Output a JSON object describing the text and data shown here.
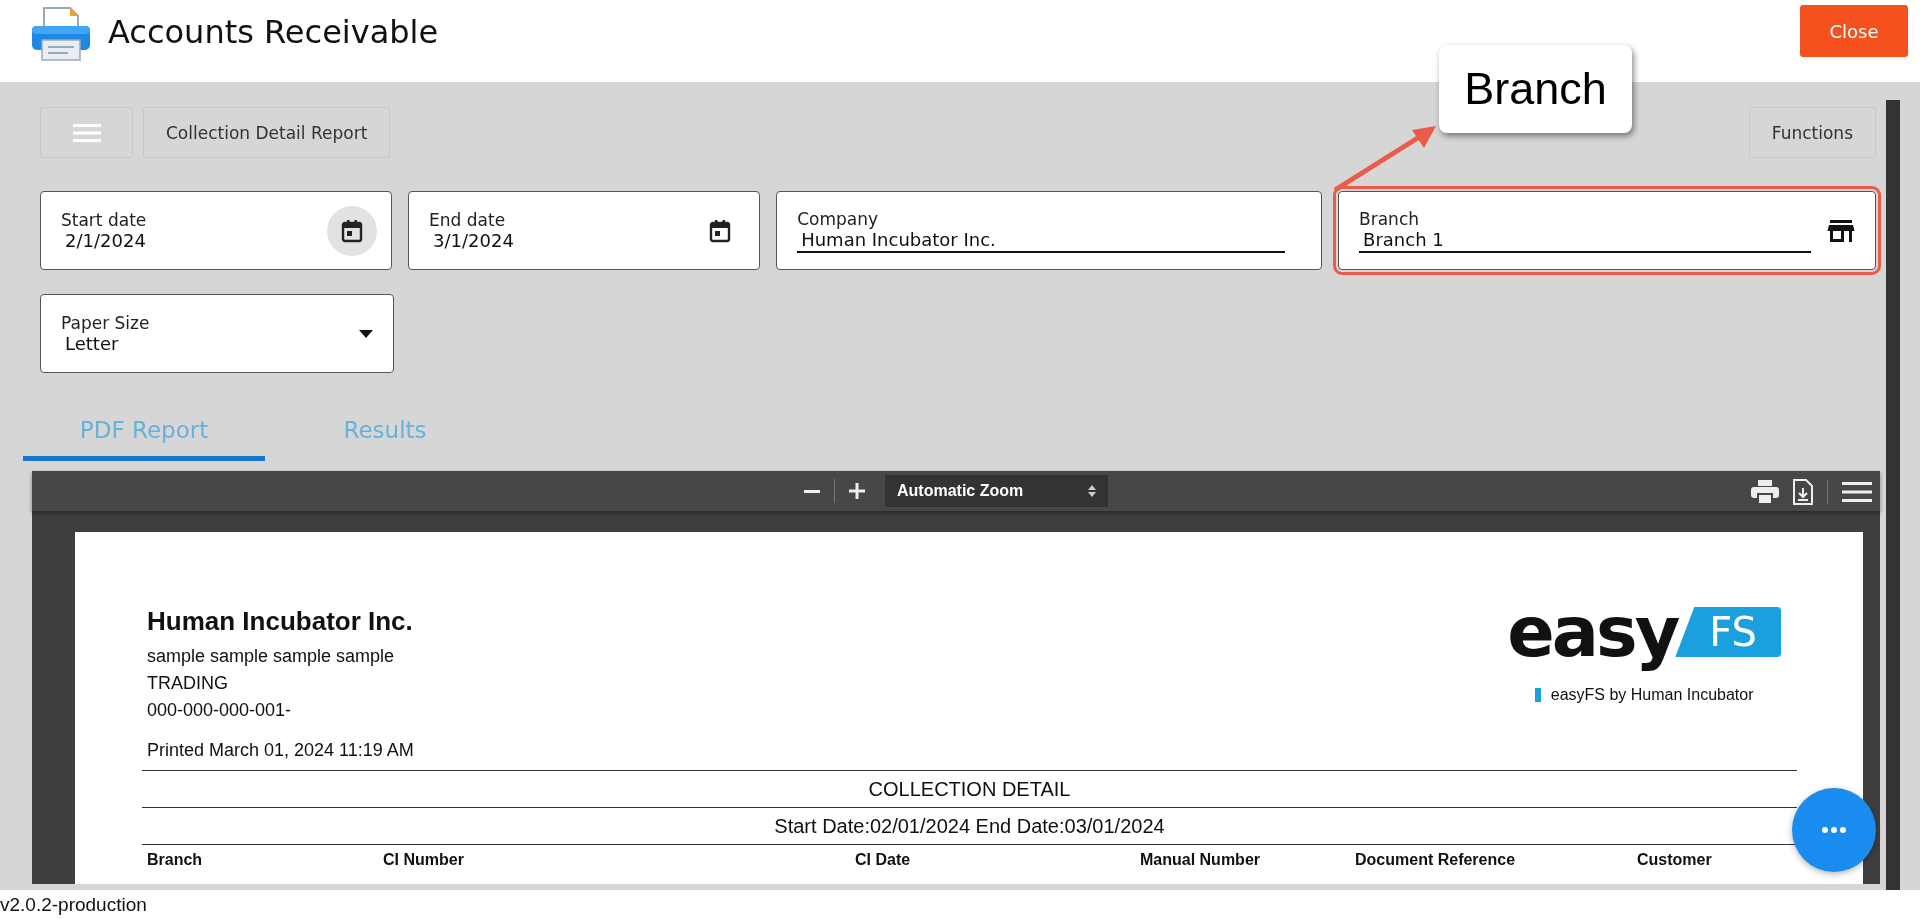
{
  "header": {
    "title": "Accounts Receivable",
    "close_button": "Close"
  },
  "toolbar": {
    "report_title": "Collection Detail Report",
    "functions_button": "Functions"
  },
  "callout": {
    "text": "Branch"
  },
  "fields": [
    {
      "kind": "date",
      "label": "Start date",
      "value": "2/1/2024",
      "icon_highlighted": true,
      "annotated": false
    },
    {
      "kind": "date",
      "label": "End date",
      "value": "3/1/2024",
      "icon_highlighted": false,
      "annotated": false
    },
    {
      "kind": "text",
      "label": "Company",
      "value": "Human Incubator Inc.",
      "annotated": false
    },
    {
      "kind": "store",
      "label": "Branch",
      "value": "Branch 1",
      "annotated": true
    },
    {
      "kind": "select",
      "label": "Paper Size",
      "value": "Letter",
      "annotated": false
    }
  ],
  "tabs": [
    {
      "label": "PDF Report",
      "selected": true
    },
    {
      "label": "Results",
      "selected": false
    }
  ],
  "pdf_viewer": {
    "zoom": "Automatic Zoom",
    "page": {
      "company": "Human Incubator Inc.",
      "company_lines": [
        "sample sample sample sample",
        "TRADING",
        " 000-000-000-001-"
      ],
      "printed": "Printed March 01, 2024 11:19 AM",
      "logo": {
        "word_1": "easy",
        "word_2": "FS",
        "tagline": "easyFS by Human Incubator"
      },
      "report_title": "COLLECTION DETAIL",
      "date_range": "Start Date:02/01/2024 End Date:03/01/2024",
      "columns": [
        "Branch",
        "CI Number",
        "CI Date",
        "Manual Number",
        "Document Reference",
        "Customer"
      ]
    }
  },
  "footer": {
    "version": "v2.0.2-production"
  }
}
